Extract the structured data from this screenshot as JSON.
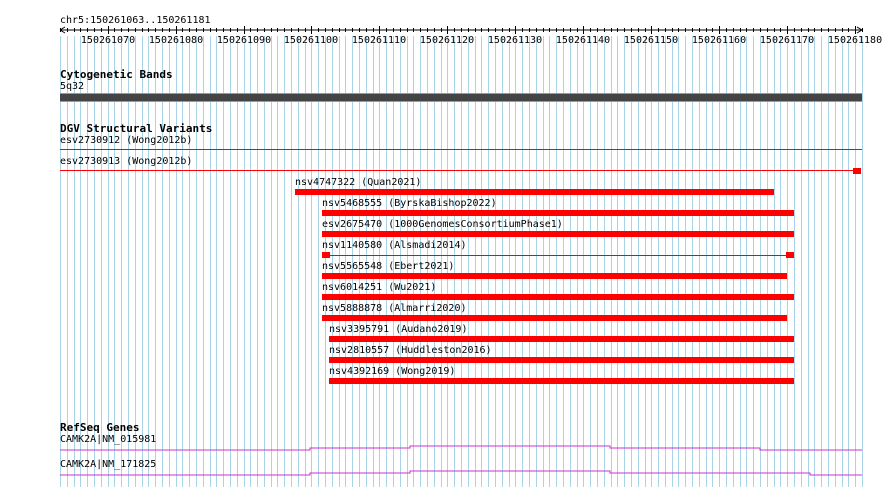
{
  "ruler": {
    "region": "chr5:150261063..150261181",
    "ticks": [
      "150261070",
      "150261080",
      "150261090",
      "150261100",
      "150261110",
      "150261120",
      "150261130",
      "150261140",
      "150261150",
      "150261160",
      "150261170",
      "150261180"
    ]
  },
  "cytobands": {
    "title": "Cytogenetic Bands",
    "band": "5q32"
  },
  "dgv": {
    "title": "DGV Structural Variants",
    "variants": [
      {
        "label": "esv2730912 (Wong2012b)"
      },
      {
        "label": "esv2730913 (Wong2012b)"
      },
      {
        "label": "nsv4747322 (Quan2021)"
      },
      {
        "label": "nsv5468555 (ByrskaBishop2022)"
      },
      {
        "label": "esv2675470 (1000GenomesConsortiumPhase1)"
      },
      {
        "label": "nsv1140580 (Alsmadi2014)"
      },
      {
        "label": "nsv5565548 (Ebert2021)"
      },
      {
        "label": "nsv6014251 (Wu2021)"
      },
      {
        "label": "nsv5888878 (Almarri2020)"
      },
      {
        "label": "nsv3395791 (Audano2019)"
      },
      {
        "label": "nsv2810557 (Huddleston2016)"
      },
      {
        "label": "nsv4392169 (Wong2019)"
      }
    ]
  },
  "refseq": {
    "title": "RefSeq Genes",
    "genes": [
      {
        "label": "CAMK2A|NM_015981"
      },
      {
        "label": "CAMK2A|NM_171825"
      }
    ]
  },
  "colors": {
    "variant": "#ff0000",
    "gene": "#cc33cc",
    "grid": "#a9d3e6",
    "band": "#444444"
  }
}
